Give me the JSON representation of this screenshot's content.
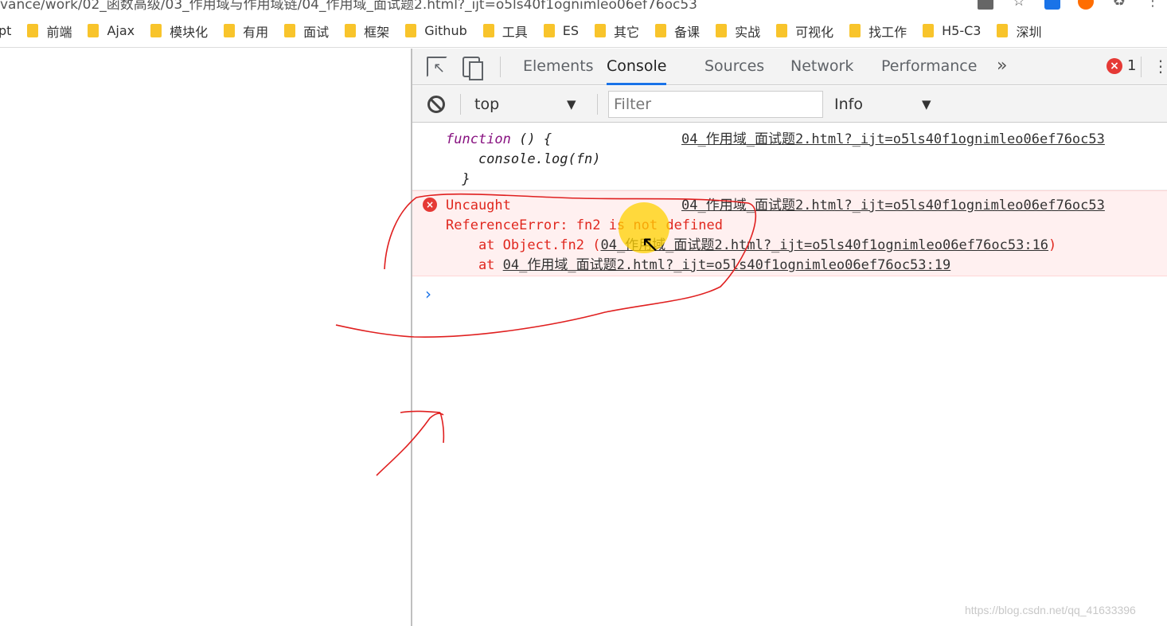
{
  "browser": {
    "url": "vance/work/02_函数高级/03_作用域与作用域链/04_作用域_面试题2.html?_ijt=o5ls40f1ognimleo06ef76oc53"
  },
  "bookmarks": [
    "pt",
    "前端",
    "Ajax",
    "模块化",
    "有用",
    "面试",
    "框架",
    "Github",
    "工具",
    "ES",
    "其它",
    "备课",
    "实战",
    "可视化",
    "找工作",
    "H5-C3",
    "深圳"
  ],
  "devtools": {
    "tabs": [
      "Elements",
      "Console",
      "Sources",
      "Network",
      "Performance"
    ],
    "active_tab": "Console",
    "more_tabs": "»",
    "error_count": "1",
    "kebab": "⋮",
    "toolbar": {
      "context": "top",
      "filter_placeholder": "Filter",
      "levels": "Info"
    }
  },
  "console": {
    "log": {
      "line1_kw": "function",
      "line1_rest": " () {",
      "line2": "    console.log(fn)",
      "line3": "  }",
      "source": "04_作用域_面试题2.html?_ijt=o5ls40f1ognimleo06ef76oc53"
    },
    "error": {
      "line1": "Uncaught",
      "line2": "ReferenceError: fn2 is not defined",
      "line3_prefix": "    at Object.fn2 (",
      "line3_link": "04_作用域_面试题2.html?_ijt=o5ls40f1ognimleo06ef76oc53:16",
      "line3_suffix": ")",
      "line4_prefix": "    at ",
      "line4_link": "04_作用域_面试题2.html?_ijt=o5ls40f1ognimleo06ef76oc53:19",
      "source": "04_作用域_面试题2.html?_ijt=o5ls40f1ognimleo06ef76oc53"
    },
    "prompt": "›"
  },
  "watermark": "https://blog.csdn.net/qq_41633396",
  "colors": {
    "accent": "#1a73e8",
    "error_text": "#e0281f",
    "error_bg": "#fff0f0",
    "annotation": "#e02020"
  }
}
